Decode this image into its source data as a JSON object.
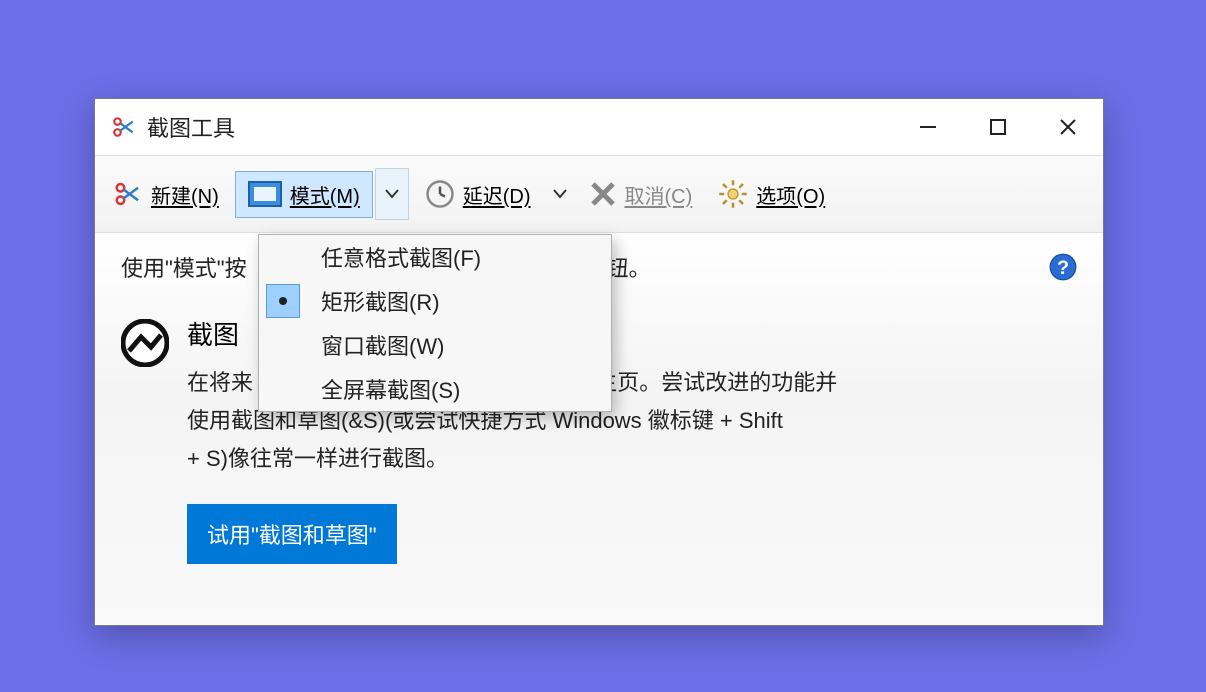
{
  "window": {
    "title": "截图工具"
  },
  "toolbar": {
    "new_label": "新建(N)",
    "mode_label": "模式(M)",
    "delay_label": "延迟(D)",
    "cancel_label": "取消(C)",
    "options_label": "选项(O)"
  },
  "hint": {
    "text_left": "使用\"模式\"按",
    "text_right": "钮。"
  },
  "mode_menu": {
    "items": [
      {
        "label": "任意格式截图(F)",
        "selected": false
      },
      {
        "label": "矩形截图(R)",
        "selected": true
      },
      {
        "label": "窗口截图(W)",
        "selected": false
      },
      {
        "label": "全屏幕截图(S)",
        "selected": false
      }
    ]
  },
  "body": {
    "title_visible": "截图",
    "line1_left": "在将来",
    "line1_right": "主页。尝试改进的功能并",
    "line2": "使用截图和草图(&S)(或尝试快捷方式 Windows 徽标键 + Shift",
    "line3": "+ S)像往常一样进行截图。",
    "try_button": "试用\"截图和草图\""
  }
}
